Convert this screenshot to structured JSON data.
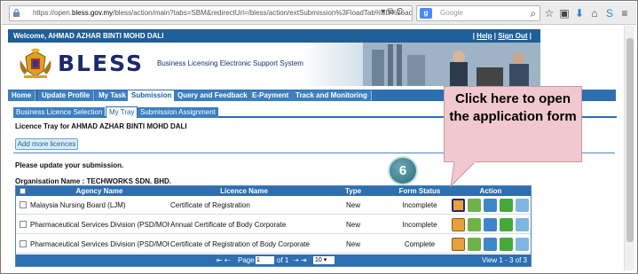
{
  "browser": {
    "url_prefix": "https://open.",
    "url_host": "bless.gov.my",
    "url_rest": "/bless/action/main?tabs=SBM&redirectUrl=/bless/action/extSubmission%3FloadTab%3D%26act%3DextSul",
    "search_placeholder": "Google"
  },
  "header": {
    "welcome": "Welcome, AHMAD AZHAR BINTI MOHD DALI",
    "help_link": "Help",
    "signout_link": "Sign Out",
    "logo_text": "BLESS",
    "logo_subtitle": "Business Licensing Electronic Support System"
  },
  "main_nav": [
    {
      "label": "Home"
    },
    {
      "label": "Update Profile"
    },
    {
      "label": "My Task"
    },
    {
      "label": "Submission",
      "active": true
    },
    {
      "label": "Query and Feedback"
    },
    {
      "label": "E-Payment"
    },
    {
      "label": "Track and Monitoring"
    }
  ],
  "sub_nav": [
    {
      "label": "Business Licence Selection"
    },
    {
      "label": "My Tray",
      "active": true
    },
    {
      "label": "Submission Assignment"
    }
  ],
  "tray": {
    "title": "Licence Tray for AHMAD AZHAR BINTI MOHD DALI",
    "add_button": "Add more licences",
    "update_message": "Please update your submission.",
    "org_label": "Organisation Name",
    "org_value": "TECHWORKS SDN. BHD."
  },
  "table": {
    "headers": {
      "agency": "Agency Name",
      "licence": "Licence Name",
      "type": "Type",
      "status": "Form Status",
      "action": "Action"
    },
    "rows": [
      {
        "agency": "Malaysia Nursing Board (LJM)",
        "licence": "Certificate of Registration",
        "type": "New",
        "status": "Incomplete"
      },
      {
        "agency": "Pharmaceutical Services Division (PSD/MOH)",
        "licence": "Annual Certificate of Body Corporate",
        "type": "New",
        "status": "Incomplete"
      },
      {
        "agency": "Pharmaceutical Services Division (PSD/MOH)",
        "licence": "Certificate of Registration of Body Corporate",
        "type": "New",
        "status": "Complete"
      }
    ],
    "pager": {
      "page_label": "Page",
      "page_value": "1",
      "of_label": "of 1",
      "page_size": "10",
      "view_text": "View 1 - 3 of 3"
    }
  },
  "callout": {
    "step_number": "6",
    "text": "Click here to open the application form"
  }
}
